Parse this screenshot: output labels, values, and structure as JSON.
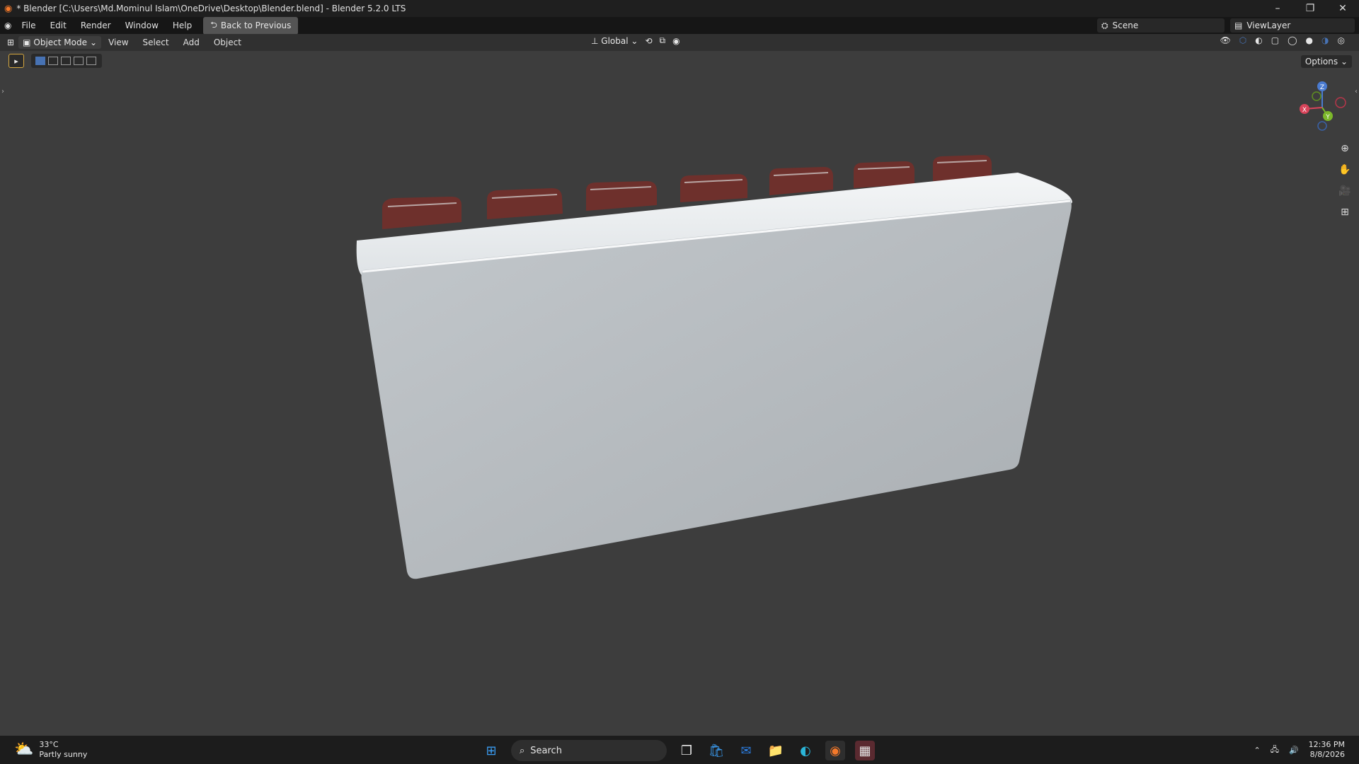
{
  "window": {
    "title": "* Blender [C:\\Users\\Md.Mominul Islam\\OneDrive\\Desktop\\Blender.blend] - Blender 5.2.0 LTS"
  },
  "menubar": {
    "items": [
      "File",
      "Edit",
      "Render",
      "Window",
      "Help"
    ],
    "back_label": "Back to Previous",
    "scene": "Scene",
    "view_layer": "ViewLayer"
  },
  "header3d": {
    "mode": "Object Mode",
    "menus": [
      "View",
      "Select",
      "Add",
      "Object"
    ],
    "orientation": "Global"
  },
  "viewport": {
    "options_label": "Options",
    "gizmo": {
      "x": "X",
      "y": "Y",
      "z": "Z"
    }
  },
  "taskbar": {
    "temp": "33°C",
    "weather": "Partly sunny",
    "search": "Search",
    "time": "12:36 PM",
    "date": "8/8/2026"
  },
  "colors": {
    "accent": "#4772b3",
    "chair": "#6e302c",
    "table": "#e8ecee"
  }
}
